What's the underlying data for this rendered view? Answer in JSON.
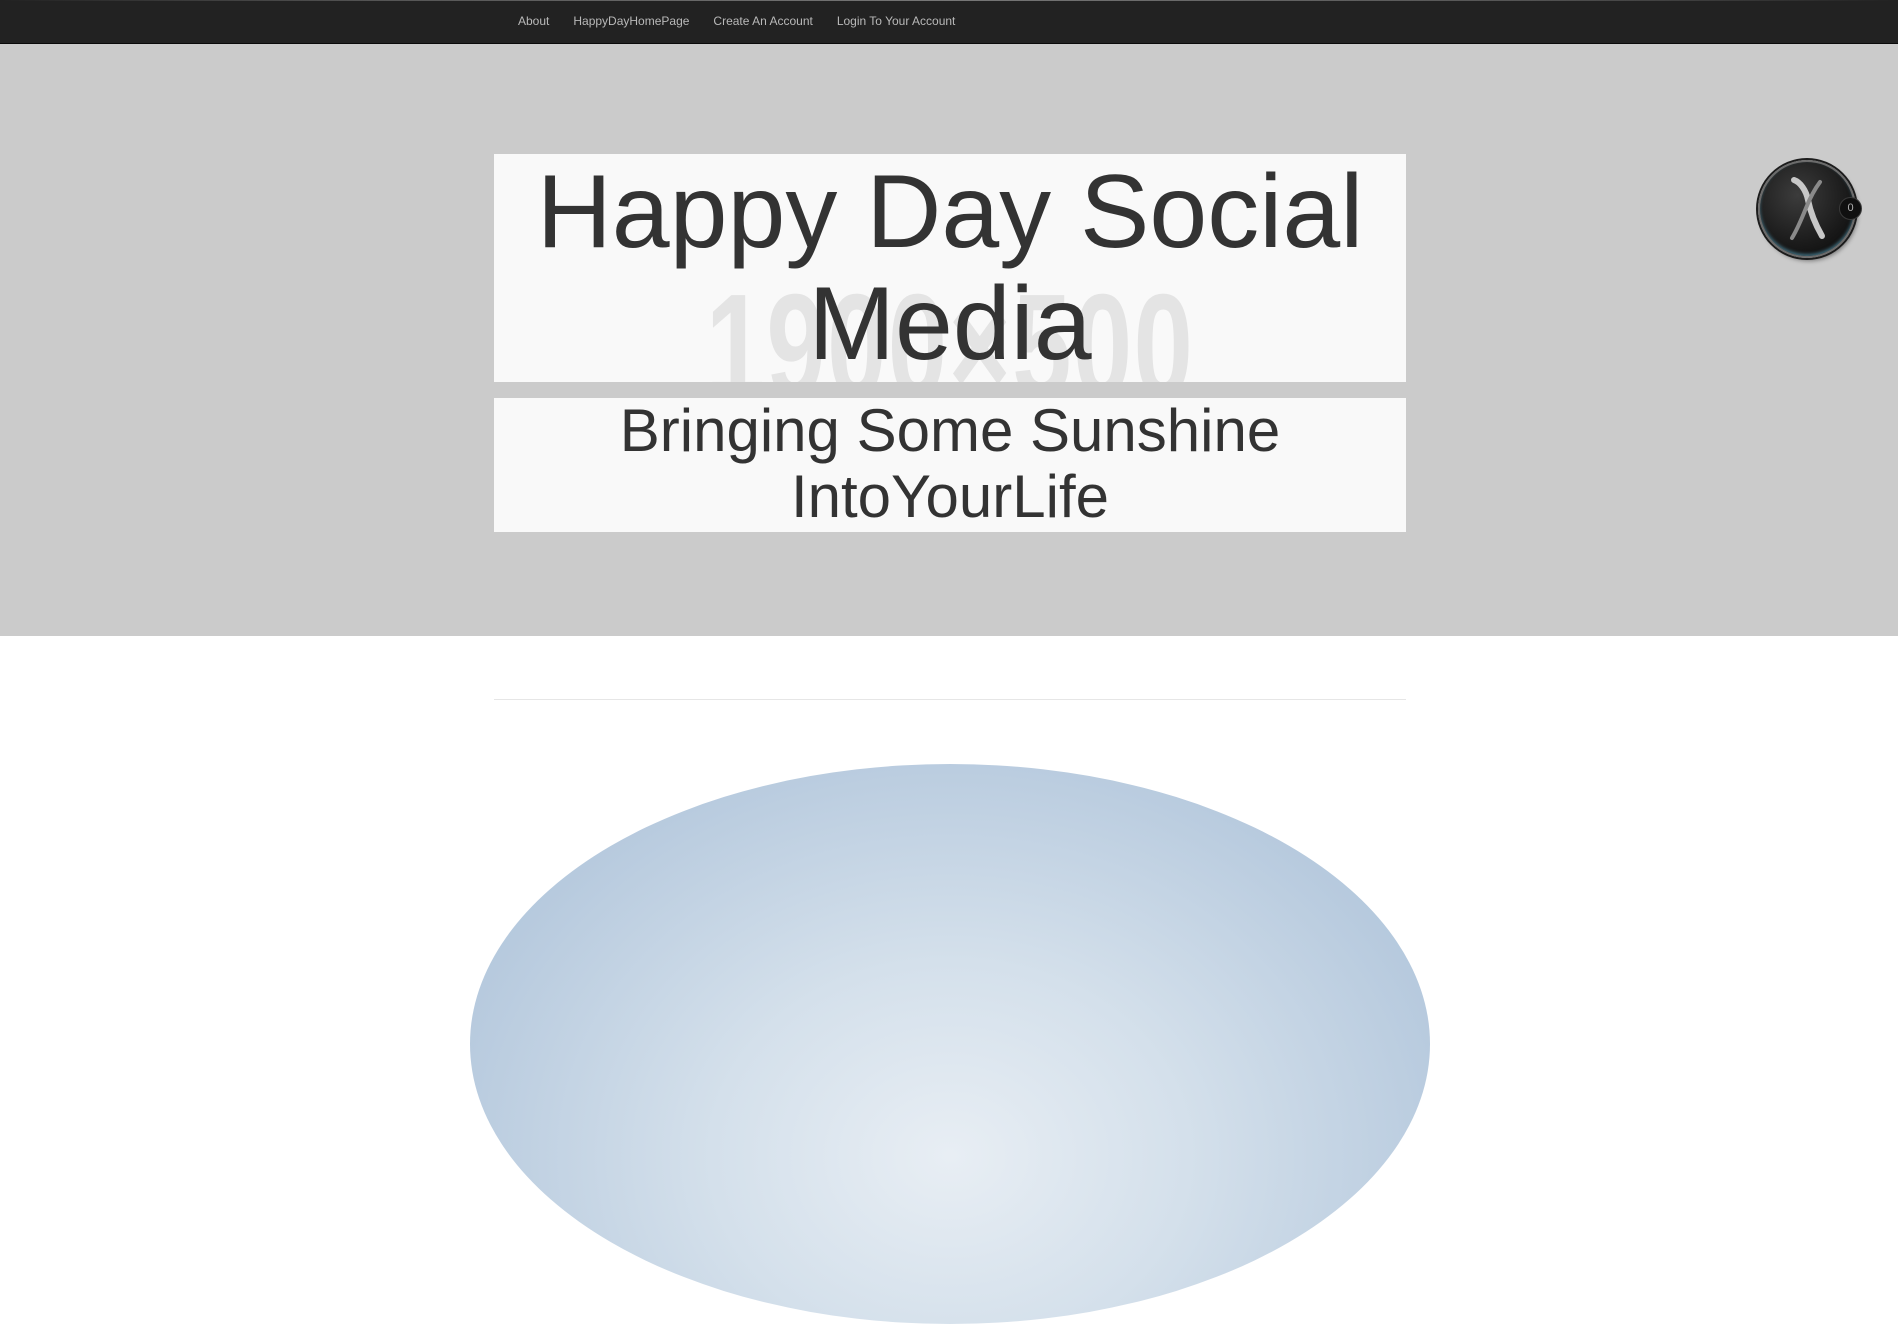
{
  "nav": {
    "items": [
      {
        "label": "About"
      },
      {
        "label": "HappyDayHomePage"
      },
      {
        "label": "Create An Account"
      },
      {
        "label": "Login To Your Account"
      }
    ]
  },
  "hero": {
    "title": "Happy Day Social Media",
    "watermark": "1900×500",
    "tagline": "Bringing Some Sunshine IntoYourLife"
  },
  "widget": {
    "icon": "x-logo-icon",
    "badge": "0"
  },
  "colors": {
    "nav_background": "#222222",
    "hero_background": "#cbcbcb",
    "box_background": "#f9f9f9",
    "text": "#333333"
  }
}
